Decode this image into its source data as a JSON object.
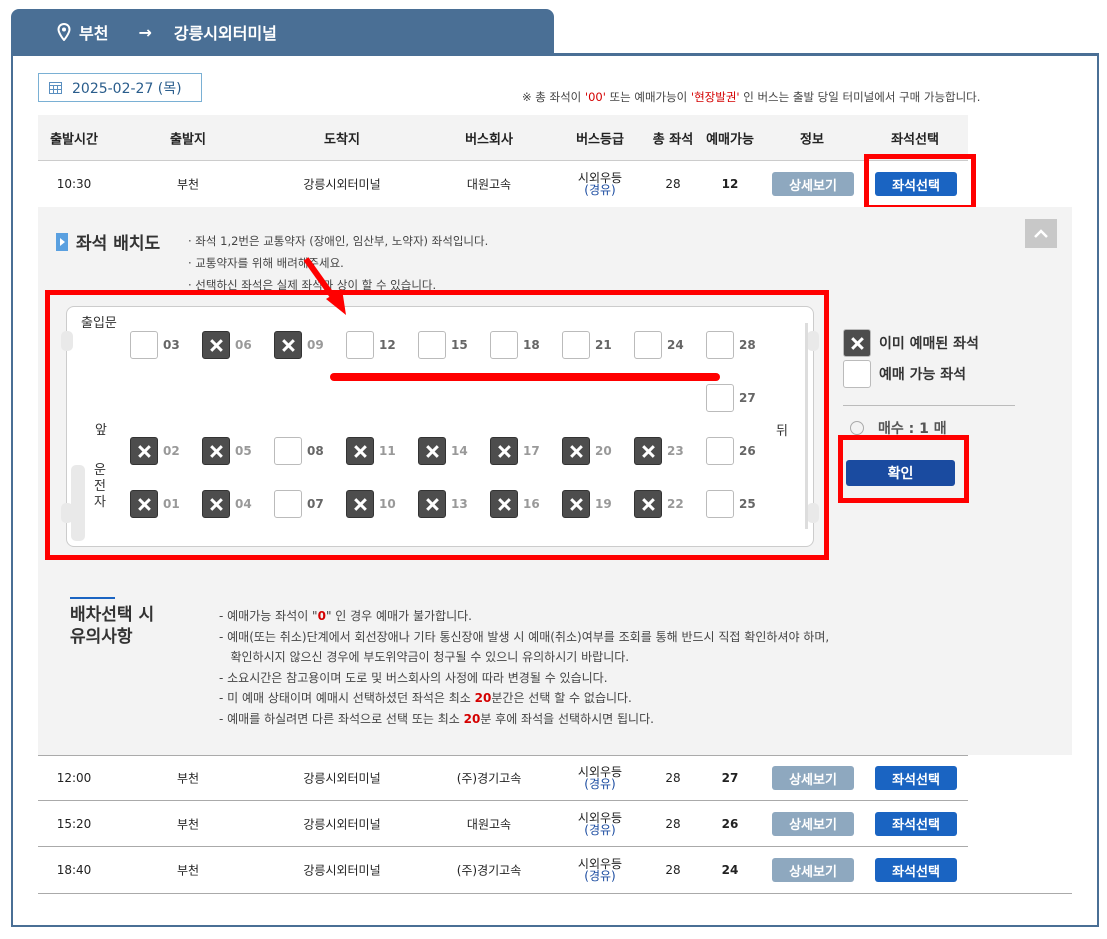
{
  "route": {
    "from": "부천",
    "arrow": "→",
    "to": "강릉시외터미널"
  },
  "date": "2025-02-27 (목)",
  "notice_top": {
    "pre": "※ 총 좌석이 ",
    "zero": "'00'",
    "mid": " 또는 예매가능이 ",
    "field": "'현장발권'",
    "post": " 인 버스는 출발 당일 터미널에서 구매 가능합니다."
  },
  "columns": [
    "출발시간",
    "출발지",
    "도착지",
    "버스회사",
    "버스등급",
    "총 좌석",
    "예매가능",
    "정보",
    "좌석선택"
  ],
  "rows": [
    {
      "time": "10:30",
      "from": "부천",
      "to": "강릉시외터미널",
      "company": "대원고속",
      "grade": "시외우등",
      "via": "(경유)",
      "total": "28",
      "available": "12",
      "detail": "상세보기",
      "select": "좌석선택"
    },
    {
      "time": "12:00",
      "from": "부천",
      "to": "강릉시외터미널",
      "company": "(주)경기고속",
      "grade": "시외우등",
      "via": "(경유)",
      "total": "28",
      "available": "27",
      "detail": "상세보기",
      "select": "좌석선택"
    },
    {
      "time": "15:20",
      "from": "부천",
      "to": "강릉시외터미널",
      "company": "대원고속",
      "grade": "시외우등",
      "via": "(경유)",
      "total": "28",
      "available": "26",
      "detail": "상세보기",
      "select": "좌석선택"
    },
    {
      "time": "18:40",
      "from": "부천",
      "to": "강릉시외터미널",
      "company": "(주)경기고속",
      "grade": "시외우등",
      "via": "(경유)",
      "total": "28",
      "available": "24",
      "detail": "상세보기",
      "select": "좌석선택"
    }
  ],
  "panel": {
    "title": "좌석 배치도",
    "notes": [
      "· 좌석 1,2번은 교통약자 (장애인, 임산부, 노약자) 좌석입니다.",
      "· 교통약자를 위해 배려해주세요.",
      "· 선택하신 좌석은 실제 좌석과 상이 할 수 있습니다."
    ]
  },
  "seatmap": {
    "door": "출입문",
    "front": "앞",
    "driver": [
      "운",
      "전",
      "자"
    ],
    "back": "뒤",
    "row_top": [
      {
        "n": "03",
        "b": false
      },
      {
        "n": "06",
        "b": true
      },
      {
        "n": "09",
        "b": true
      },
      {
        "n": "12",
        "b": false
      },
      {
        "n": "15",
        "b": false
      },
      {
        "n": "18",
        "b": false
      },
      {
        "n": "21",
        "b": false
      },
      {
        "n": "24",
        "b": false
      },
      {
        "n": "28",
        "b": false
      }
    ],
    "extra": [
      {
        "n": "27",
        "b": false
      }
    ],
    "row_mid": [
      {
        "n": "02",
        "b": true
      },
      {
        "n": "05",
        "b": true
      },
      {
        "n": "08",
        "b": false
      },
      {
        "n": "11",
        "b": true
      },
      {
        "n": "14",
        "b": true
      },
      {
        "n": "17",
        "b": true
      },
      {
        "n": "20",
        "b": true
      },
      {
        "n": "23",
        "b": true
      },
      {
        "n": "26",
        "b": false
      }
    ],
    "row_bot": [
      {
        "n": "01",
        "b": true
      },
      {
        "n": "04",
        "b": true
      },
      {
        "n": "07",
        "b": false
      },
      {
        "n": "10",
        "b": true
      },
      {
        "n": "13",
        "b": true
      },
      {
        "n": "16",
        "b": true
      },
      {
        "n": "19",
        "b": true
      },
      {
        "n": "22",
        "b": true
      },
      {
        "n": "25",
        "b": false
      }
    ]
  },
  "legend": {
    "booked": "이미 예매된 좌석",
    "available": "예매 가능 좌석"
  },
  "count": "매수 : 1 매",
  "confirm": "확인",
  "caution": {
    "title_1": "배차선택 시",
    "title_2": "유의사항",
    "items": [
      {
        "pre": "- 예매가능 좌석이 \"",
        "hl": "0",
        "post": "\" 인 경우 예매가 불가합니다."
      },
      {
        "pre": "- 예매(또는 취소)단계에서 회선장애나 기타 통신장애 발생 시 예매(취소)여부를 조회를 통해 반드시 직접 확인하셔야 하며,",
        "hl": "",
        "post": ""
      },
      {
        "pre": "   확인하시지 않으신 경우에 부도위약금이 청구될 수 있으니 유의하시기 바랍니다.",
        "hl": "",
        "post": ""
      },
      {
        "pre": "- 소요시간은 참고용이며 도로 및 버스회사의 사정에 따라 변경될 수 있습니다.",
        "hl": "",
        "post": ""
      },
      {
        "pre": "- 미 예매 상태이며 예매시 선택하셨던 좌석은 최소 ",
        "hl": "20",
        "post": "분간은 선택 할 수 없습니다."
      },
      {
        "pre": "- 예매를 하실려면 다른 좌석으로 선택 또는 최소 ",
        "hl": "20",
        "post": "분 후에 좌석을 선택하시면 됩니다."
      }
    ]
  }
}
